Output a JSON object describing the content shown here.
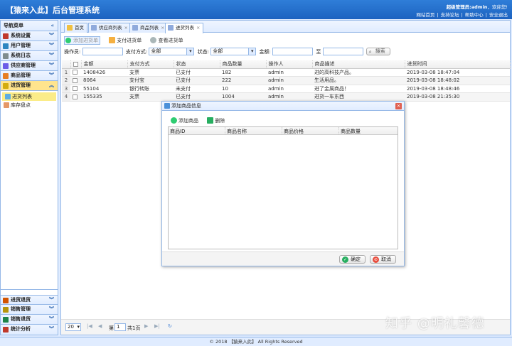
{
  "header": {
    "title": "【猿来入此】后台管理系统",
    "user_prefix": "超级管理员:",
    "username": "admin",
    "welcome": "，欢迎您!",
    "links": [
      "网站首页",
      "支持论坛",
      "帮助中心",
      "安全退出"
    ]
  },
  "sidebar": {
    "title": "导航菜单",
    "items": [
      {
        "label": "系统设置",
        "icon": "wrench-icon",
        "color": "#c0392b"
      },
      {
        "label": "用户管理",
        "icon": "user-icon",
        "color": "#2e86c1"
      },
      {
        "label": "系统日志",
        "icon": "log-icon",
        "color": "#7f8c8d"
      },
      {
        "label": "供应商管理",
        "icon": "supplier-icon",
        "color": "#6c5ce7"
      },
      {
        "label": "商品管理",
        "icon": "goods-icon",
        "color": "#e67e22"
      },
      {
        "label": "进货管理",
        "icon": "purchase-icon",
        "color": "#d4ac0d"
      }
    ],
    "subitems": [
      {
        "label": "进货列表",
        "icon": "list-icon"
      },
      {
        "label": "库存盘点",
        "icon": "inventory-icon"
      }
    ],
    "bottom_items": [
      {
        "label": "进货退货",
        "icon": "return-icon",
        "color": "#d35400"
      },
      {
        "label": "销售管理",
        "icon": "sales-icon",
        "color": "#b7950b"
      },
      {
        "label": "销售退货",
        "icon": "sales-return-icon",
        "color": "#1e8449"
      },
      {
        "label": "统计分析",
        "icon": "stats-icon",
        "color": "#c0392b"
      }
    ]
  },
  "tabs": [
    {
      "label": "首页",
      "closable": false
    },
    {
      "label": "供应商列表",
      "closable": true
    },
    {
      "label": "商品列表",
      "closable": true
    },
    {
      "label": "进货列表",
      "closable": true
    }
  ],
  "toolbar": {
    "add": "添加进货单",
    "pay": "支付进货单",
    "view": "查看进货单"
  },
  "filter": {
    "operator_label": "操作员:",
    "pay_label": "支付方式:",
    "pay_value": "全部",
    "status_label": "状态:",
    "status_value": "全部",
    "amount_label": "金额:",
    "to_label": "至",
    "search": "搜索"
  },
  "grid": {
    "columns": [
      "金额",
      "支付方式",
      "状态",
      "商品数量",
      "操作人",
      "商品描述",
      "进货时间"
    ],
    "rows": [
      {
        "n": "1",
        "amount": "1408426",
        "pay": "支票",
        "status": "已支付",
        "qty": "182",
        "op": "admin",
        "desc": "进的高科技产品。",
        "time": "2019-03-08 18:47:04"
      },
      {
        "n": "2",
        "amount": "8064",
        "pay": "支付宝",
        "status": "已支付",
        "qty": "222",
        "op": "admin",
        "desc": "生活用品。",
        "time": "2019-03-08 18:48:02"
      },
      {
        "n": "3",
        "amount": "55104",
        "pay": "银行转账",
        "status": "未支付",
        "qty": "10",
        "op": "admin",
        "desc": "进了金属商品！",
        "time": "2019-03-08 18:48:46"
      },
      {
        "n": "4",
        "amount": "155335",
        "pay": "支票",
        "status": "已支付",
        "qty": "1004",
        "op": "admin",
        "desc": "进货一车东西",
        "time": "2019-03-08 21:35:30"
      }
    ]
  },
  "pager": {
    "page_size": "20",
    "page_prefix": "第",
    "page": "1",
    "page_suffix": "共1页"
  },
  "dialog": {
    "title": "添加商品信息",
    "add": "添加商品",
    "remove": "删除",
    "columns": [
      "商品ID",
      "商品名称",
      "商品价格",
      "商品数量"
    ],
    "ok": "确定",
    "cancel": "取消"
  },
  "footer": "© 2018 【猿来入此】 All Rights Reserved",
  "watermark": "知乎 @明礼馨德"
}
